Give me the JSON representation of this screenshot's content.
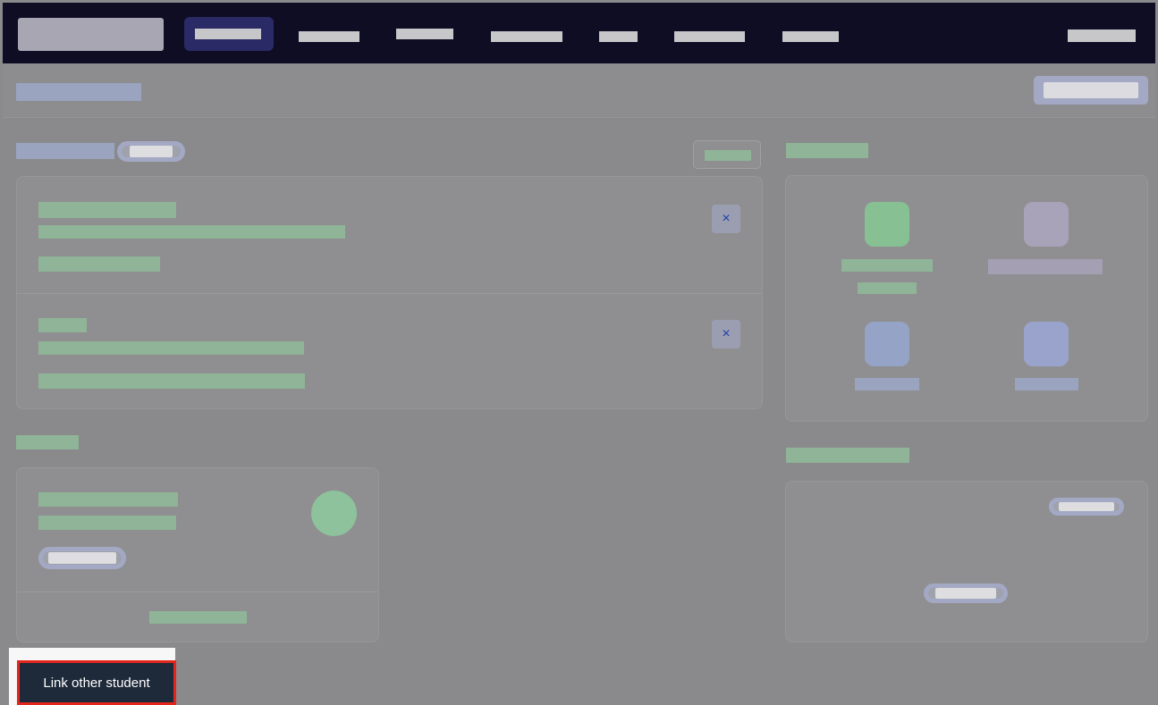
{
  "overlay_button": {
    "label": "Link other student"
  },
  "cards": {
    "remove_icon": "×"
  },
  "icons": {
    "close": "close-icon"
  },
  "colors": {
    "nav_bg": "#0e0d24",
    "highlight_border": "#e3261c",
    "button_bg": "#1e2a3a"
  }
}
